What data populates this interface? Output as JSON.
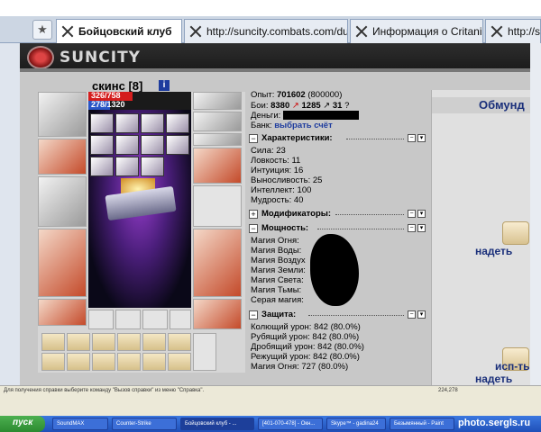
{
  "browser": {
    "tabs": [
      {
        "label": "Бойцовский клуб",
        "active": true
      },
      {
        "label": "http://suncity.combats.com/dun...",
        "active": false
      },
      {
        "label": "Информация о Critanik",
        "active": false
      },
      {
        "label": "http://su",
        "active": false
      }
    ]
  },
  "game": {
    "logo": "SUNCITY",
    "character": {
      "name": "скинс",
      "level": "[8]",
      "info_icon": "i"
    },
    "hp": {
      "text": "326/758",
      "current": 326,
      "max": 758
    },
    "mana": {
      "text": "278/1320",
      "current": 278,
      "max": 1320
    },
    "stats": {
      "experience_label": "Опыт:",
      "experience_value": "701602",
      "experience_next": "(800000)",
      "battles_label": "Бои:",
      "battles_wins": "8380",
      "battles_losses": "1285",
      "battles_draws": "31",
      "battles_help": "?",
      "money_label": "Деньги:",
      "bank_label": "Банк:",
      "bank_link": "выбрать счёт"
    },
    "characteristics": {
      "title": "Характеристики:",
      "items": [
        "Сила: 23",
        "Ловкость: 11",
        "Интуиция: 16",
        "Выносливость: 25",
        "Интеллект: 100",
        "Мудрость: 40"
      ]
    },
    "modifiers": {
      "title": "Модификаторы:"
    },
    "power": {
      "title": "Мощность:",
      "items": [
        "Магия Огня:",
        "Магия Воды:",
        "Магия Воздух",
        "Магия Земли:",
        "Магия Света:",
        "Магия Тьмы:",
        "Серая магия:"
      ]
    },
    "protection": {
      "title": "Защита:",
      "items": [
        "Колющий урон: 842 (80.0%)",
        "Рубящий урон: 842 (80.0%)",
        "Дробящий урон: 842 (80.0%)",
        "Режущий урон: 842 (80.0%)",
        "Магия Огня: 727 (80.0%)"
      ]
    },
    "right_panel": {
      "header": "Обмунд",
      "action1": "надеть",
      "action2_line1": "исп-ть",
      "action2_line2": "надеть"
    }
  },
  "statusbar": {
    "message": "Для получения справки выберите команду \"Вызов справки\" из меню \"Справка\".",
    "coords": "224,278"
  },
  "taskbar": {
    "start": "пуск",
    "items": [
      "SoundMAX",
      "Counter-Strike",
      "Бойцовский клуб - ...",
      "[401-070-478] - Окн...",
      "Skype™ - gadina24",
      "Безымянный - Paint"
    ],
    "watermark": "photo.sergls.ru"
  }
}
